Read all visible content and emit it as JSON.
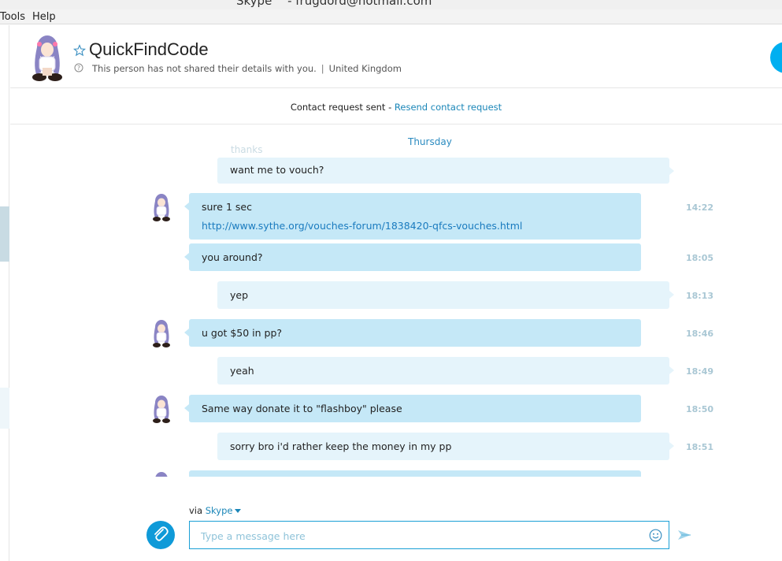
{
  "window": {
    "title": "Skype™ - frugdord@hotmail.com"
  },
  "menu": {
    "tools": "Tools",
    "help": "Help"
  },
  "contact": {
    "name": "QuickFindCode",
    "details": "This person has not shared their details with you.",
    "location": "United Kingdom"
  },
  "request_bar": {
    "status": "Contact request sent - ",
    "resend_link": "Resend contact request"
  },
  "chat": {
    "day_label": "Thursday",
    "faded_previous_message": "thanks",
    "messages": [
      {
        "direction": "out",
        "lines": [
          "want me to vouch?"
        ],
        "time": ""
      },
      {
        "direction": "in",
        "lines": [
          "sure 1 sec"
        ],
        "link": "http://www.sythe.org/vouches-forum/1838420-qfcs-vouches.html",
        "time": "14:22"
      },
      {
        "direction": "in",
        "lines": [
          "you around?"
        ],
        "time": "18:05"
      },
      {
        "direction": "out",
        "lines": [
          "yep"
        ],
        "time": "18:13"
      },
      {
        "direction": "in",
        "lines": [
          "u got $50 in pp?"
        ],
        "time": "18:46"
      },
      {
        "direction": "out",
        "lines": [
          "yeah"
        ],
        "time": "18:49"
      },
      {
        "direction": "in",
        "lines": [
          "Same way donate it to \"flashboy\" please"
        ],
        "time": "18:50"
      },
      {
        "direction": "out",
        "lines": [
          "sorry bro i'd rather keep the money in my pp"
        ],
        "time": "18:51"
      }
    ]
  },
  "composer": {
    "via_prefix": "via ",
    "via_service": "Skype",
    "placeholder": "Type a message here",
    "value": ""
  },
  "icons": {
    "star": "star-icon",
    "info": "info-icon",
    "attach": "paperclip-icon",
    "emoji": "emoji-icon",
    "send": "send-icon",
    "call": "call-icon"
  },
  "colors": {
    "accent": "#00aff0",
    "link": "#1a86b8",
    "incoming_bubble": "#c5e8f7",
    "outgoing_bubble": "#e5f4fb",
    "timestamp": "#a9c7d4"
  }
}
